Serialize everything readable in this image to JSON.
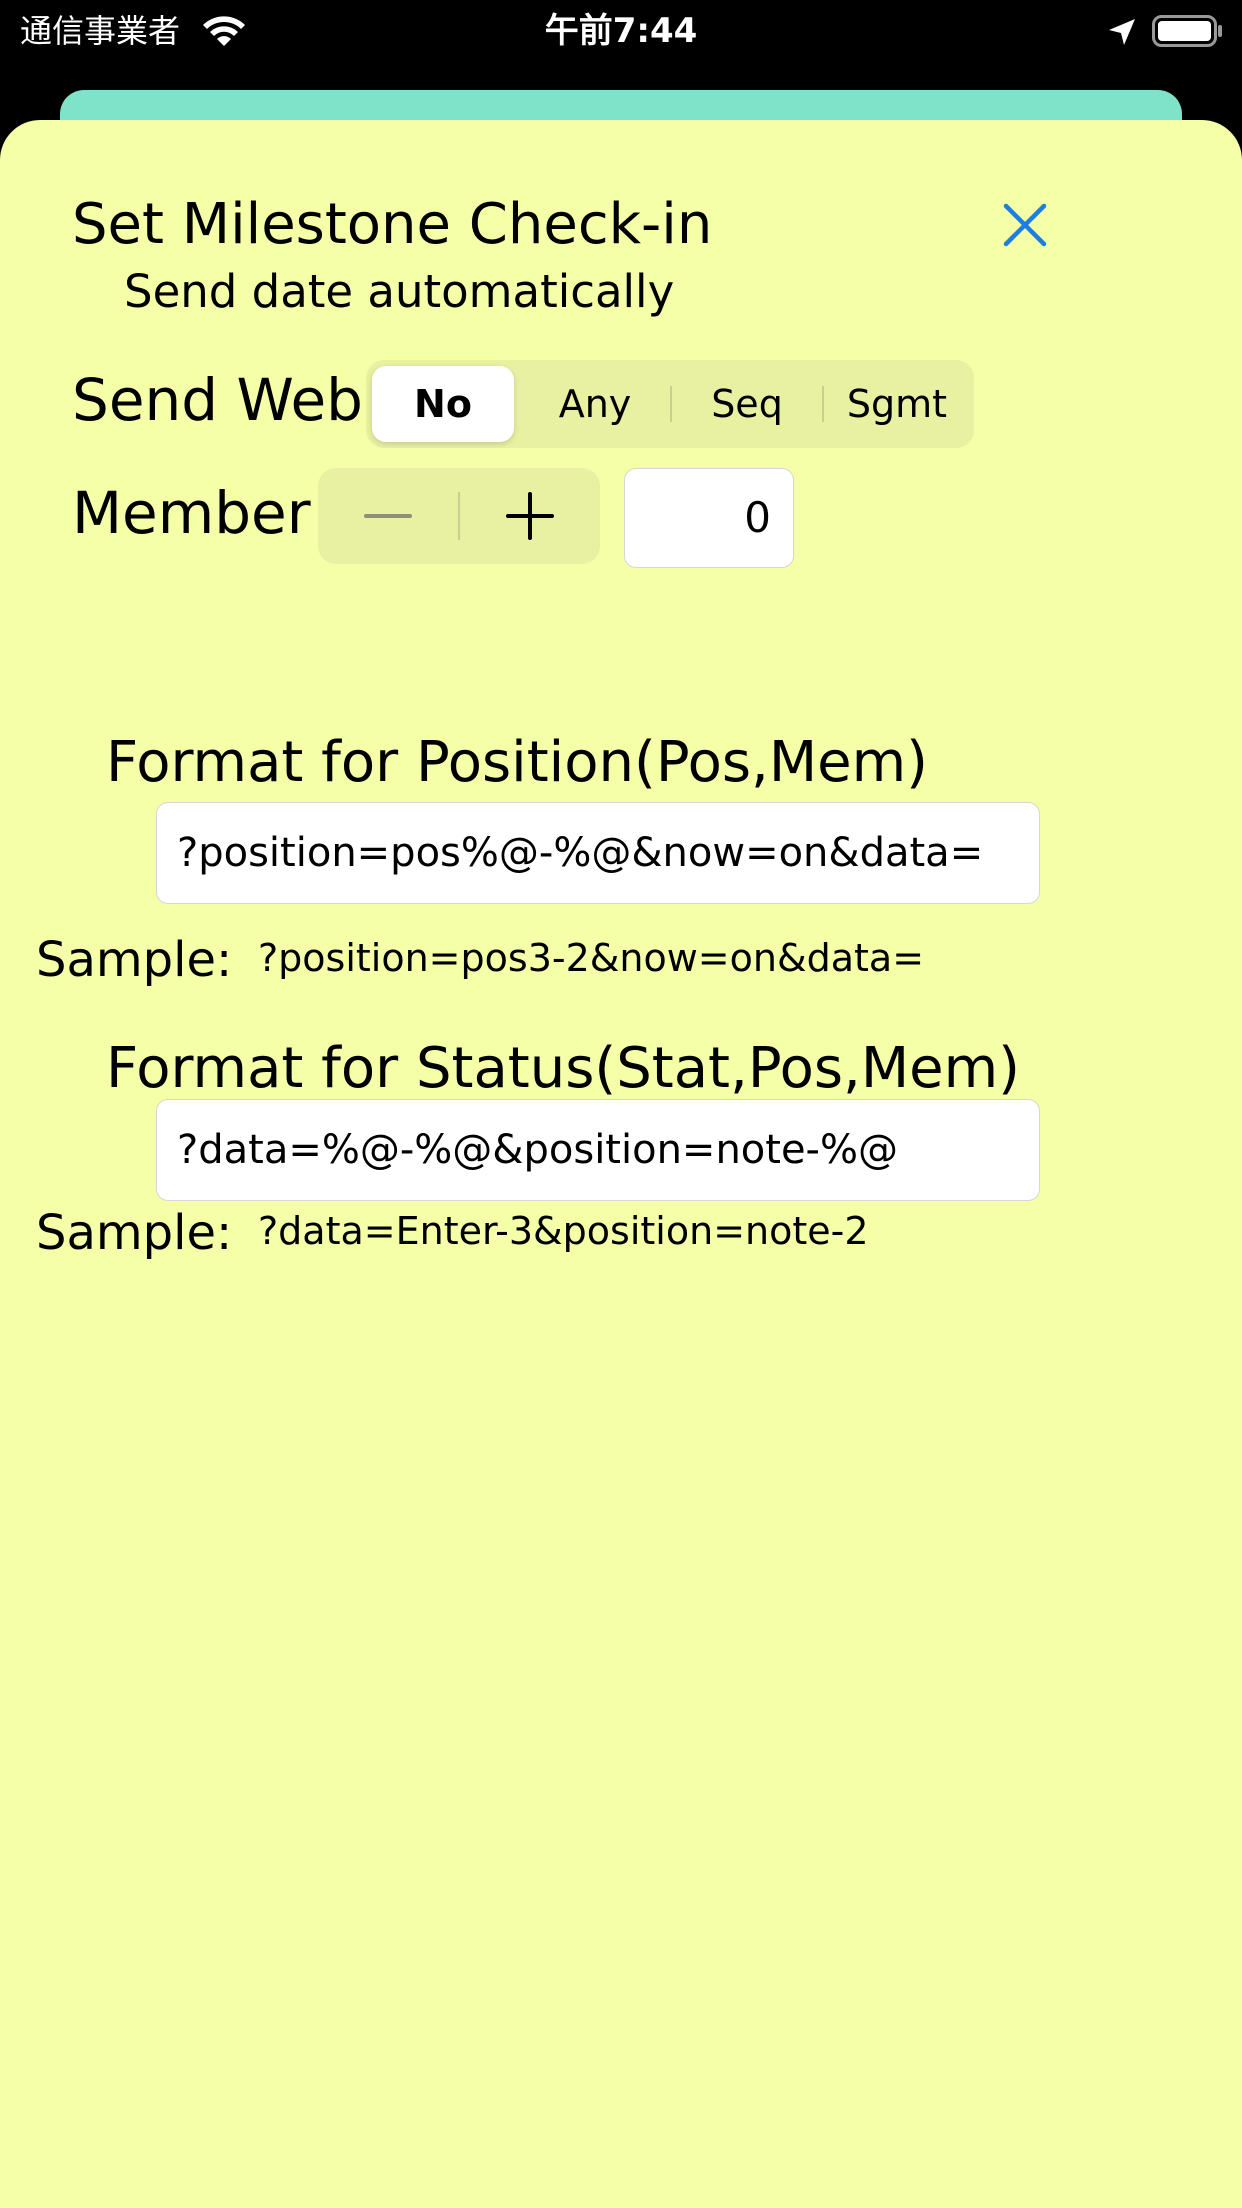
{
  "status_bar": {
    "carrier": "通信事業者",
    "time": "午前7:44",
    "icons": [
      "wifi-icon",
      "location-arrow-icon",
      "battery-icon"
    ]
  },
  "dialog": {
    "title": "Set Milestone Check-in",
    "subtitle": "Send date automatically",
    "close_icon": "close-icon",
    "accent_color": "#1a7fe0",
    "background_color": "#f5ffa8"
  },
  "send_web": {
    "label": "Send Web",
    "options": [
      "No",
      "Any",
      "Seq",
      "Sgmt"
    ],
    "selected": "No"
  },
  "member": {
    "label": "Member",
    "decrement_icon": "minus-icon",
    "increment_icon": "plus-icon",
    "value": "0"
  },
  "position_format": {
    "title": "Format for Position(Pos,Mem)",
    "value": "?position=pos%@-%@&now=on&data=",
    "sample_label": "Sample:",
    "sample_value": "?position=pos3-2&now=on&data="
  },
  "status_format": {
    "title": "Format for Status(Stat,Pos,Mem)",
    "value": "?data=%@-%@&position=note-%@",
    "sample_label": "Sample:",
    "sample_value": "?data=Enter-3&position=note-2"
  }
}
